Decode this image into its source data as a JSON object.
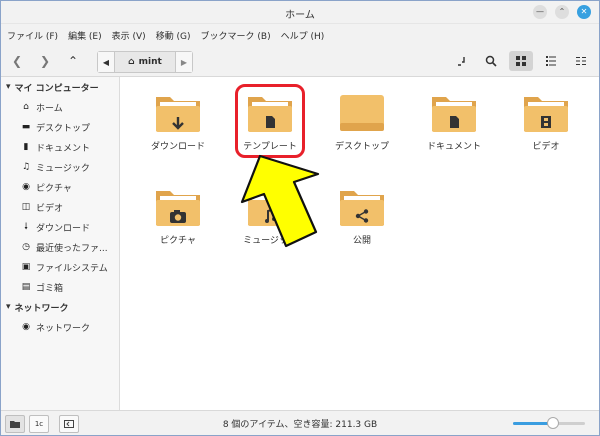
{
  "window": {
    "title": "ホーム"
  },
  "menu": [
    "ファイル (F)",
    "編集 (E)",
    "表示 (V)",
    "移動 (G)",
    "ブックマーク (B)",
    "ヘルプ (H)"
  ],
  "toolbar": {
    "path_crumb": "mint"
  },
  "sidebar": {
    "sections": [
      {
        "header": "マイ コンピューター",
        "items": [
          {
            "label": "ホーム",
            "icon": "home-icon"
          },
          {
            "label": "デスクトップ",
            "icon": "desktop-icon"
          },
          {
            "label": "ドキュメント",
            "icon": "document-icon"
          },
          {
            "label": "ミュージック",
            "icon": "music-icon"
          },
          {
            "label": "ピクチャ",
            "icon": "camera-icon"
          },
          {
            "label": "ビデオ",
            "icon": "film-icon"
          },
          {
            "label": "ダウンロード",
            "icon": "download-icon"
          },
          {
            "label": "最近使ったファ...",
            "icon": "clock-icon"
          },
          {
            "label": "ファイルシステム",
            "icon": "drive-icon"
          },
          {
            "label": "ゴミ箱",
            "icon": "trash-icon"
          }
        ]
      },
      {
        "header": "ネットワーク",
        "items": [
          {
            "label": "ネットワーク",
            "icon": "network-icon"
          }
        ]
      }
    ]
  },
  "files": [
    {
      "label": "ダウンロード",
      "icon": "download-icon"
    },
    {
      "label": "テンプレート",
      "icon": "template-icon"
    },
    {
      "label": "デスクトップ",
      "icon": "desktop-icon"
    },
    {
      "label": "ドキュメント",
      "icon": "document-icon"
    },
    {
      "label": "ビデオ",
      "icon": "film-icon"
    },
    {
      "label": "ピクチャ",
      "icon": "camera-icon"
    },
    {
      "label": "ミュージック",
      "icon": "music-icon"
    },
    {
      "label": "公開",
      "icon": "share-icon"
    }
  ],
  "status": {
    "text": "8 個のアイテム、空き容量: 211.3 GB",
    "zoom_fraction": 0.55
  },
  "colors": {
    "folder_body": "#f2c06a",
    "folder_tab": "#e0a44c",
    "accent": "#3a9de0",
    "highlight": "#e8202a",
    "arrow_fill": "#ffff00"
  }
}
